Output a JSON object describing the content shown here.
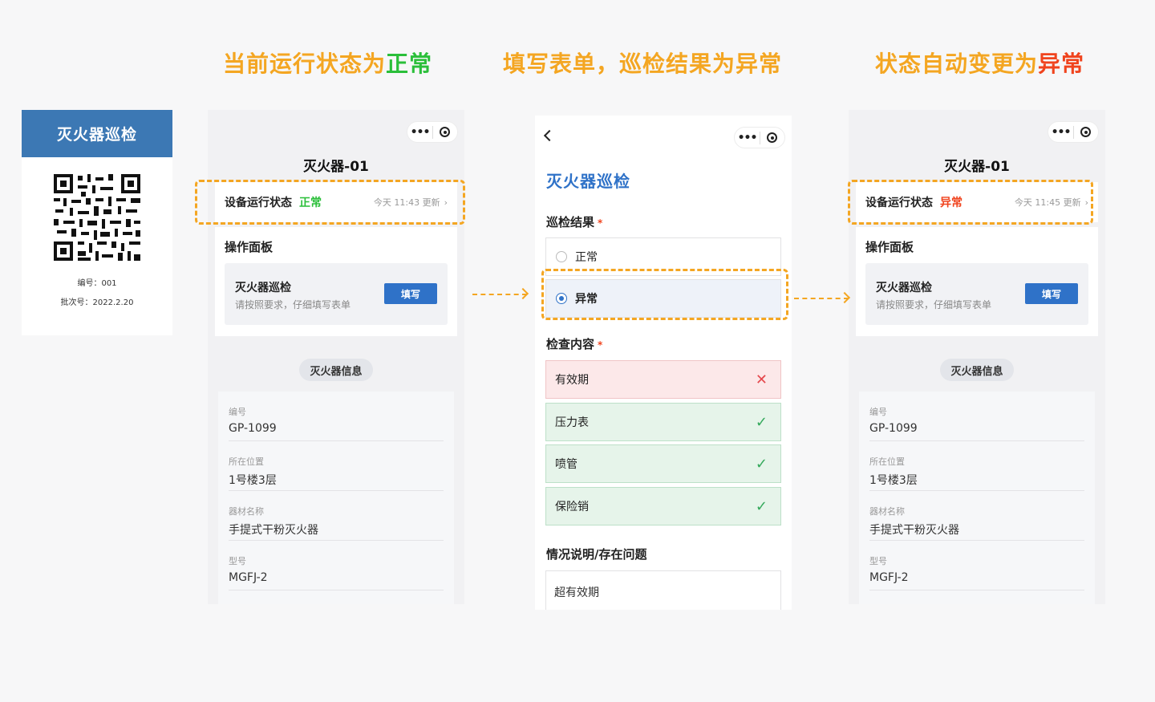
{
  "captions": {
    "step1_prefix": "当前运行状态为",
    "step1_status": "正常",
    "step2": "填写表单，巡检结果为异常",
    "step3_prefix": "状态自动变更为",
    "step3_status": "异常"
  },
  "qr_card": {
    "title": "灭火器巡检",
    "number_label": "编号：001",
    "batch_label": "批次号：2022.2.20"
  },
  "capsule": {
    "more_icon": "more-dots-icon",
    "close_icon": "target-ring-icon"
  },
  "left_phone": {
    "title": "灭火器-01",
    "status_label": "设备运行状态",
    "status_value": "正常",
    "status_time": "今天 11:43 更新",
    "panel_title": "操作面板",
    "task_name": "灭火器巡检",
    "task_desc": "请按照要求，仔细填写表单",
    "fill_button": "填写",
    "info_badge": "灭火器信息",
    "info": [
      {
        "key": "编号",
        "value": "GP-1099"
      },
      {
        "key": "所在位置",
        "value": "1号楼3层"
      },
      {
        "key": "器材名称",
        "value": "手提式干粉灭火器"
      },
      {
        "key": "型号",
        "value": "MGFJ-2"
      }
    ]
  },
  "middle_phone": {
    "form_title": "灭火器巡检",
    "result_label": "巡检结果",
    "required_mark": "*",
    "option_normal": "正常",
    "option_abnormal": "异常",
    "check_label": "检查内容",
    "checks": [
      {
        "name": "有效期",
        "state": "fail"
      },
      {
        "name": "压力表",
        "state": "pass"
      },
      {
        "name": "喷管",
        "state": "pass"
      },
      {
        "name": "保险销",
        "state": "pass"
      }
    ],
    "note_label": "情况说明/存在问题",
    "note_value": "超有效期"
  },
  "right_phone": {
    "title": "灭火器-01",
    "status_label": "设备运行状态",
    "status_value": "异常",
    "status_time": "今天 11:45 更新",
    "panel_title": "操作面板",
    "task_name": "灭火器巡检",
    "task_desc": "请按照要求，仔细填写表单",
    "fill_button": "填写",
    "info_badge": "灭火器信息",
    "info": [
      {
        "key": "编号",
        "value": "GP-1099"
      },
      {
        "key": "所在位置",
        "value": "1号楼3层"
      },
      {
        "key": "器材名称",
        "value": "手提式干粉灭火器"
      },
      {
        "key": "型号",
        "value": "MGFJ-2"
      }
    ]
  },
  "colors": {
    "accent_orange": "#f4a622",
    "ok_green": "#2bbf3a",
    "bad_red": "#f0441e",
    "brand_blue": "#2f72c8"
  }
}
